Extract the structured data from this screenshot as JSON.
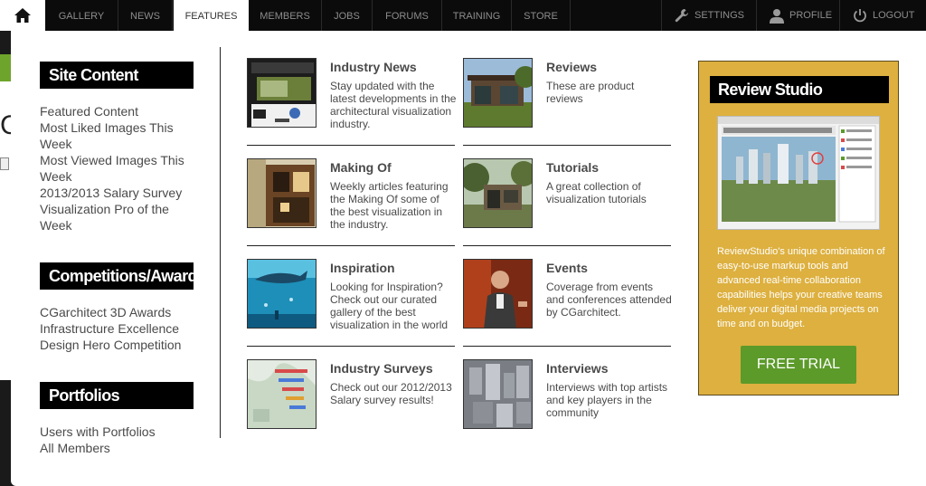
{
  "nav": {
    "items": [
      "GALLERY",
      "NEWS",
      "FEATURES",
      "MEMBERS",
      "JOBS",
      "FORUMS",
      "TRAINING",
      "STORE"
    ],
    "active": "FEATURES",
    "right": [
      {
        "label": "SETTINGS",
        "icon": "wrench-icon"
      },
      {
        "label": "PROFILE",
        "icon": "user-icon"
      },
      {
        "label": "LOGOUT",
        "icon": "power-icon"
      }
    ]
  },
  "sidebar": {
    "sections": [
      {
        "heading": "Site Content",
        "links": [
          "Featured Content",
          "Most Liked Images This Week",
          "Most Viewed Images This Week",
          "2013/2013 Salary Survey",
          "Visualization Pro of the Week"
        ]
      },
      {
        "heading": "Competitions/Awards",
        "links": [
          "CGarchitect 3D Awards",
          "Infrastructure Excellence",
          "Design Hero Competition"
        ]
      },
      {
        "heading": "Portfolios",
        "links": [
          "Users with Portfolios",
          "All Members"
        ]
      }
    ]
  },
  "features": [
    {
      "title": "Industry News",
      "desc": "Stay updated with the latest developments in the architectural visualization industry.",
      "thumb": "website-screenshot"
    },
    {
      "title": "Reviews",
      "desc": "These are product reviews",
      "thumb": "modern-house-render"
    },
    {
      "title": "Making Of",
      "desc": "Weekly articles featuring the Making Of some of the best visualization in the industry.",
      "thumb": "wooden-house-render"
    },
    {
      "title": "Tutorials",
      "desc": "A great collection of visualization tutorials",
      "thumb": "house-in-woods-render"
    },
    {
      "title": "Inspiration",
      "desc": "Looking for Inspiration? Check out our curated gallery of the best visualization in the world",
      "thumb": "aquarium-shark"
    },
    {
      "title": "Events",
      "desc": "Coverage from events and conferences attended by CGarchitect.",
      "thumb": "speaker-photo"
    },
    {
      "title": "Industry Surveys",
      "desc": "Check out our 2012/2013 Salary survey results!",
      "thumb": "survey-map"
    },
    {
      "title": "Interviews",
      "desc": "Interviews with top artists and key players in the community",
      "thumb": "aerial-city"
    }
  ],
  "promo": {
    "heading": "Review Studio",
    "text": "ReviewStudio's unique combination of easy-to-use markup tools and advanced real-time collaboration capabilities helps your creative teams deliver your digital media projects on time and on budget.",
    "button": "FREE TRIAL",
    "bg_color": "#ddb03f",
    "button_color": "#5c9a2a"
  },
  "background_page": {
    "partial_letter": "C"
  }
}
